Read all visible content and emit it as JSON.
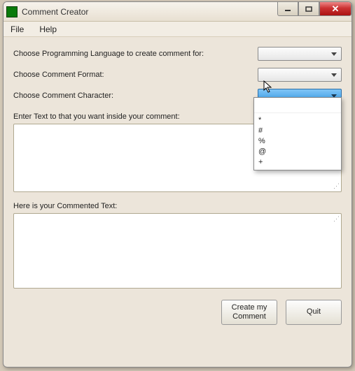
{
  "window": {
    "title": "Comment Creator"
  },
  "menubar": {
    "items": [
      "File",
      "Help"
    ]
  },
  "form": {
    "lang_label": "Choose Programming Language to create comment for:",
    "format_label": "Choose Comment Format:",
    "char_label": "Choose Comment Character:",
    "input_label": "Enter Text to that you want inside your comment:",
    "output_label": "Here is your Commented Text:"
  },
  "dropdown": {
    "options": [
      "*",
      "#",
      "%",
      "@",
      "+"
    ]
  },
  "buttons": {
    "create": "Create my\nComment",
    "quit": "Quit"
  }
}
